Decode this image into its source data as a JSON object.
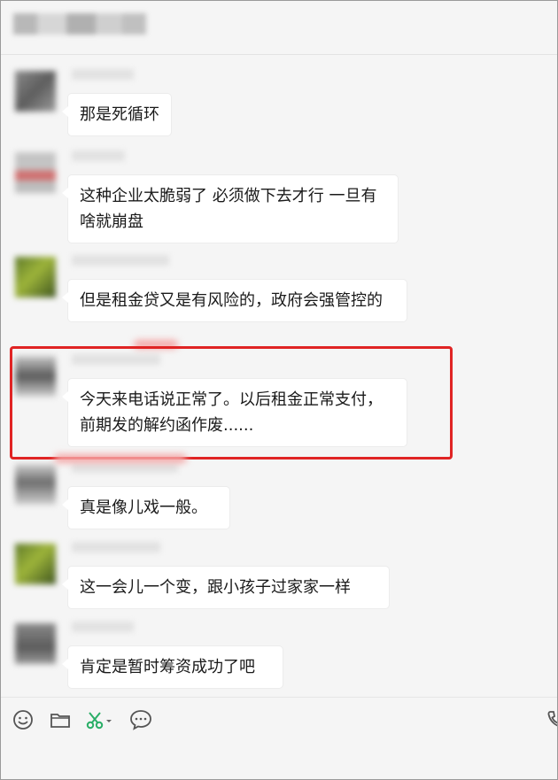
{
  "messages": [
    {
      "text": "那是死循环"
    },
    {
      "text": "这种企业太脆弱了 必须做下去才行 一旦有啥就崩盘"
    },
    {
      "text": "但是租金贷又是有风险的，政府会强管控的"
    },
    {
      "text": "今天来电话说正常了。以后租金正常支付，前期发的解约函作废......"
    },
    {
      "text": "真是像儿戏一般。"
    },
    {
      "text": "这一会儿一个变，跟小孩子过家家一样"
    },
    {
      "text": "肯定是暂时筹资成功了吧"
    }
  ],
  "toolbar": {
    "icons": [
      "emoji-icon",
      "folder-icon",
      "screenshot-scissors-icon",
      "chat-history-icon",
      "phone-icon"
    ]
  },
  "colors": {
    "highlight": "#e02424",
    "accent_green": "#2aae67",
    "background": "#f5f5f5"
  }
}
